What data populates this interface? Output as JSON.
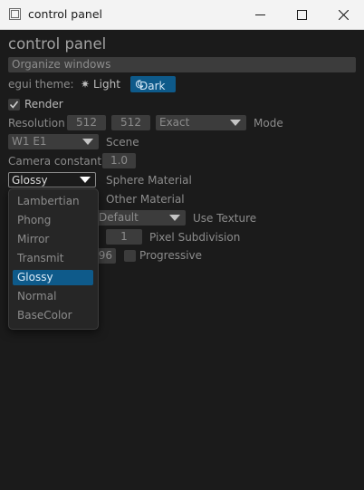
{
  "window": {
    "title": "control panel",
    "minimize_icon": "minimize-icon",
    "maximize_icon": "maximize-icon",
    "close_icon": "close-icon"
  },
  "panel": {
    "heading": "control panel",
    "organize_label": "Organize windows",
    "theme": {
      "label": "egui theme:",
      "light_icon": "sun-icon",
      "light_label": "Light",
      "dark_icon": "moon-icon",
      "dark_label": "Dark",
      "selected": "Dark"
    },
    "render": {
      "label": "Render",
      "checked": true
    },
    "resolution": {
      "label": "Resolution",
      "width": "512",
      "height": "512",
      "mode_value": "Exact",
      "mode_label": "Mode"
    },
    "scene": {
      "value": "W1 E1",
      "label": "Scene"
    },
    "camera": {
      "label": "Camera constant",
      "value": "1.0"
    },
    "sphere_material": {
      "value": "Glossy",
      "label": "Sphere Material"
    },
    "other_material": {
      "label": "Other Material"
    },
    "texture": {
      "value": "Default",
      "label": "Use Texture"
    },
    "pixel_subdivision": {
      "value": "1",
      "label": "Pixel Subdivision"
    },
    "progressive": {
      "value_visible": "96",
      "label": "Progressive",
      "checked": false
    }
  },
  "material_dropdown": {
    "options": [
      "Lambertian",
      "Phong",
      "Mirror",
      "Transmit",
      "Glossy",
      "Normal",
      "BaseColor"
    ],
    "selected": "Glossy"
  },
  "colors": {
    "background": "#1b1b1b",
    "widget": "#3c3c3c",
    "accent": "#0e5a8a",
    "text": "#8c8c8c"
  }
}
